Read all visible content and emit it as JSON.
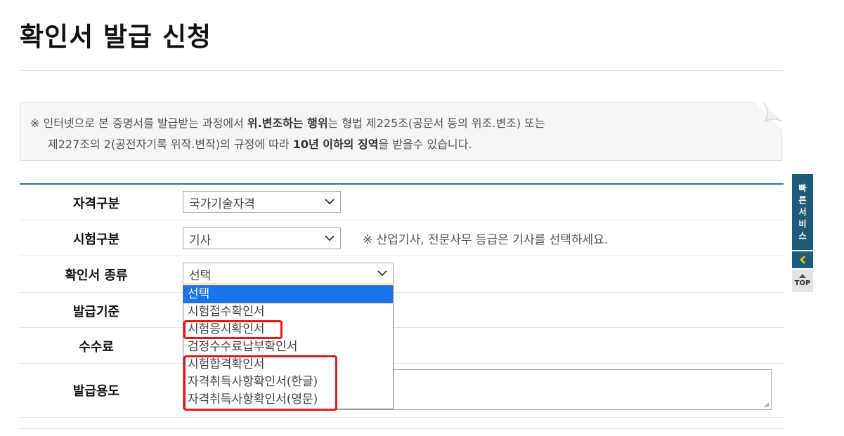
{
  "page": {
    "title": "확인서 발급 신청"
  },
  "notice": {
    "line1_prefix": "※ 인터넷으로 본 증명서를 발급받는 과정에서 ",
    "line1_bold": "위.변조하는 행위",
    "line1_suffix": "는 형법 제225조(공문서 등의 위조.변조) 또는",
    "line2_prefix": "제227조의 2(공전자기록 위작.변작)의 규정에 따라 ",
    "line2_bold": "10년 이하의 징역",
    "line2_suffix": "을 받을수 있습니다."
  },
  "form": {
    "qualification": {
      "label": "자격구분",
      "value": "국가기술자격"
    },
    "exam_type": {
      "label": "시험구분",
      "value": "기사",
      "hint": "※ 산업기사, 전문사무 등급은 기사를 선택하세요."
    },
    "certificate_type": {
      "label": "확인서 종류",
      "value": "선택",
      "options": [
        "선택",
        "시험접수확인서",
        "시험응시확인서",
        "검정수수료납부확인서",
        "시험합격확인서",
        "자격취득사항확인서(한글)",
        "자격취득사항확인서(영문)"
      ]
    },
    "issue_basis": {
      "label": "발급기준"
    },
    "fee": {
      "label": "수수료"
    },
    "purpose": {
      "label": "발급용도"
    }
  },
  "quick_menu": {
    "service_label": "빠른서비스",
    "top_label": "TOP"
  },
  "colors": {
    "accent": "#2a6db0",
    "quick_bg": "#1f5c79",
    "highlight": "#e11b1b",
    "option_selected": "#1a73e8"
  }
}
